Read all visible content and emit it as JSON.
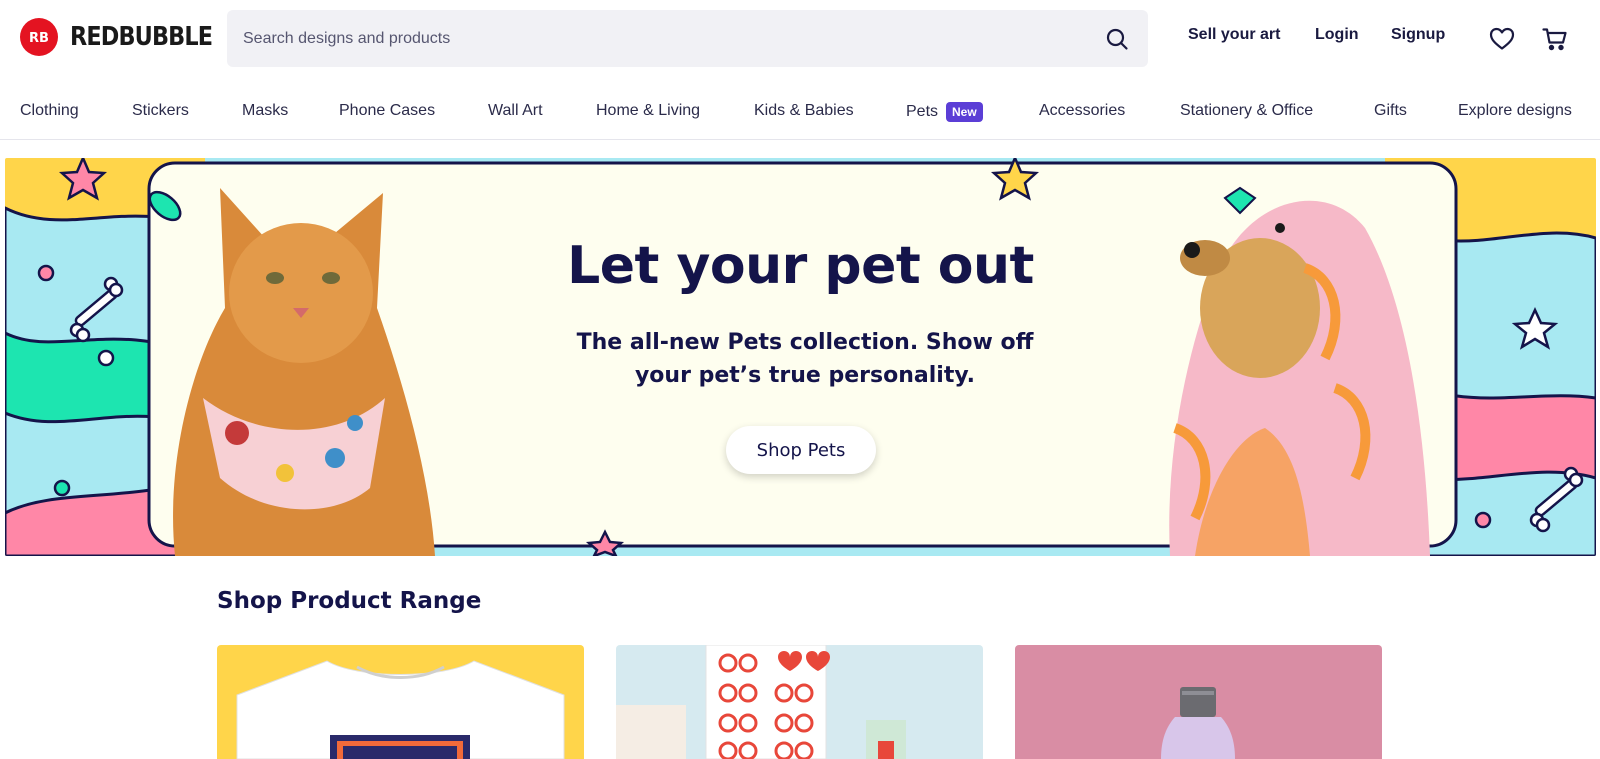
{
  "brand": {
    "name": "REDBUBBLE",
    "mark": "RB",
    "color": "#e41321"
  },
  "search": {
    "placeholder": "Search designs and products",
    "icon": "search-icon"
  },
  "header": {
    "sell": "Sell your art",
    "login": "Login",
    "signup": "Signup",
    "icons": [
      "heart-icon",
      "cart-icon"
    ]
  },
  "nav": {
    "items": [
      {
        "label": "Clothing"
      },
      {
        "label": "Stickers"
      },
      {
        "label": "Masks"
      },
      {
        "label": "Phone Cases"
      },
      {
        "label": "Wall Art"
      },
      {
        "label": "Home & Living"
      },
      {
        "label": "Kids & Babies"
      },
      {
        "label": "Pets",
        "badge": "New"
      },
      {
        "label": "Accessories"
      },
      {
        "label": "Stationery & Office"
      },
      {
        "label": "Gifts"
      },
      {
        "label": "Explore designs"
      }
    ]
  },
  "hero": {
    "title": "Let your pet out",
    "subtitle": "The all-new Pets collection. Show off your pet’s true personality.",
    "cta": "Shop Pets",
    "colors": {
      "panel": "#fefeef",
      "ink": "#14144a",
      "yellow": "#ffd54a",
      "blue": "#a8e9f2",
      "green": "#1de5b0",
      "pink": "#ff87a7"
    }
  },
  "product_range": {
    "title": "Shop Product Range",
    "cards": [
      {
        "name": "t-shirt",
        "bg": "#ffd54a"
      },
      {
        "name": "stickers",
        "bg": "#d6eaf0"
      },
      {
        "name": "water-bottle",
        "bg": "#d98da4"
      }
    ]
  }
}
